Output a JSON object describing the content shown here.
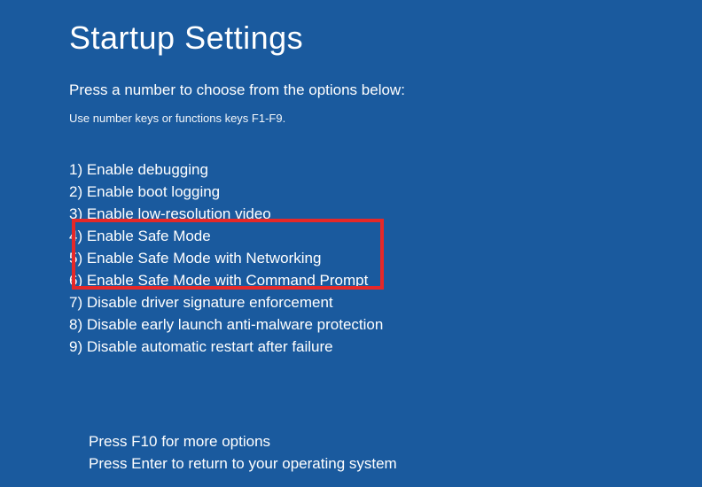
{
  "title": "Startup Settings",
  "instruction": "Press a number to choose from the options below:",
  "hint": "Use number keys or functions keys F1-F9.",
  "options": [
    {
      "num": "1) ",
      "label": "Enable debugging"
    },
    {
      "num": "2) ",
      "label": "Enable boot logging"
    },
    {
      "num": "3) ",
      "label": "Enable low-resolution video"
    },
    {
      "num": "4) ",
      "label": "Enable Safe Mode"
    },
    {
      "num": "5) ",
      "label": "Enable Safe Mode with Networking"
    },
    {
      "num": "6) ",
      "label": "Enable Safe Mode with Command Prompt"
    },
    {
      "num": "7) ",
      "label": "Disable driver signature enforcement"
    },
    {
      "num": "8) ",
      "label": "Disable early launch anti-malware protection"
    },
    {
      "num": "9) ",
      "label": "Disable automatic restart after failure"
    }
  ],
  "footer": {
    "line1": "Press F10 for more options",
    "line2": "Press Enter to return to your operating system"
  }
}
